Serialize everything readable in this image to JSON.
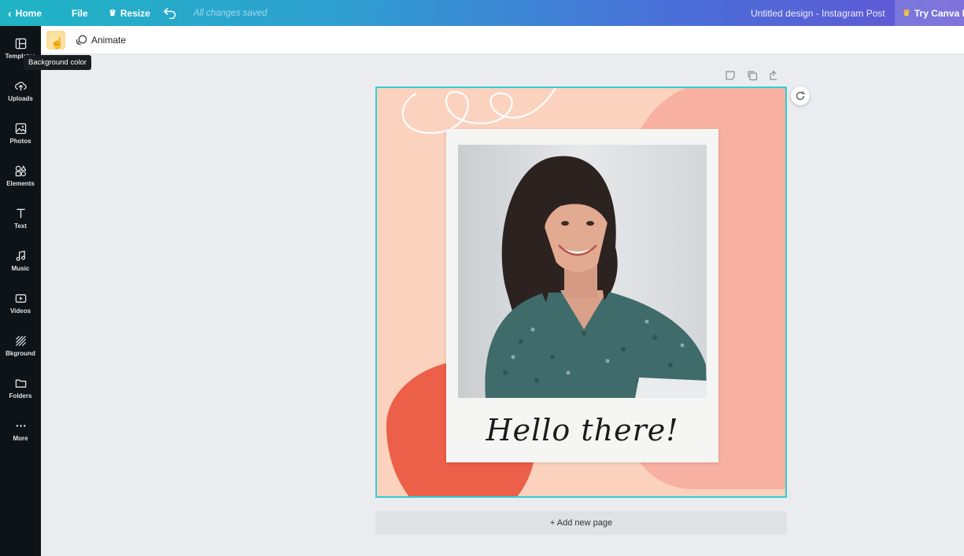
{
  "topbar": {
    "home_label": "Home",
    "file_label": "File",
    "resize_label": "Resize",
    "saved_status": "All changes saved",
    "design_title": "Untitled design - Instagram Post",
    "try_pro_label": "Try Canva Pro"
  },
  "sidebar": {
    "items": [
      {
        "label": "Templates",
        "icon": "templates-icon"
      },
      {
        "label": "Uploads",
        "icon": "upload-icon"
      },
      {
        "label": "Photos",
        "icon": "photo-icon"
      },
      {
        "label": "Elements",
        "icon": "elements-icon"
      },
      {
        "label": "Text",
        "icon": "text-icon"
      },
      {
        "label": "Music",
        "icon": "music-icon"
      },
      {
        "label": "Videos",
        "icon": "video-icon"
      },
      {
        "label": "Bkground",
        "icon": "background-icon"
      },
      {
        "label": "Folders",
        "icon": "folder-icon"
      },
      {
        "label": "More",
        "icon": "more-icon"
      }
    ]
  },
  "toolbar": {
    "background_color_tooltip": "Background color",
    "animate_label": "Animate"
  },
  "design": {
    "greeting_text": "Hello there!"
  },
  "canvas": {
    "add_page_label": "+ Add new page"
  },
  "colors": {
    "topbar_start": "#1fb4c4",
    "topbar_end": "#6454d4",
    "selection_border": "#2fd0d6",
    "design_peach": "#fbd2bd",
    "design_salmon": "#f8b0a1",
    "design_coral": "#ec5f48",
    "pro_crown": "#ffc83d"
  }
}
